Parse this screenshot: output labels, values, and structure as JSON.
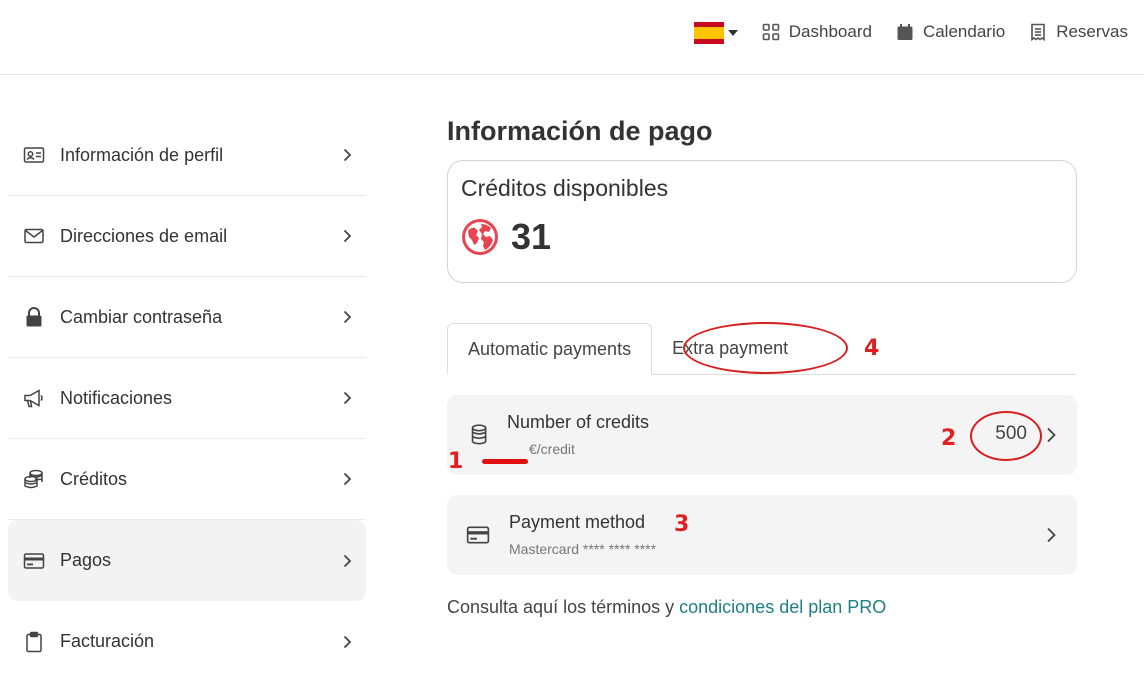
{
  "topbar": {
    "language": "es",
    "links": [
      {
        "label": "Dashboard",
        "icon": "dashboard-icon"
      },
      {
        "label": "Calendario",
        "icon": "calendar-icon"
      },
      {
        "label": "Reservas",
        "icon": "receipt-icon"
      }
    ]
  },
  "sidebar": {
    "items": [
      {
        "label": "Información de perfil",
        "icon": "id-card-icon"
      },
      {
        "label": "Direcciones de email",
        "icon": "envelope-icon"
      },
      {
        "label": "Cambiar contraseña",
        "icon": "lock-icon"
      },
      {
        "label": "Notificaciones",
        "icon": "megaphone-icon"
      },
      {
        "label": "Créditos",
        "icon": "coins-icon"
      },
      {
        "label": "Pagos",
        "icon": "credit-card-icon",
        "active": true
      },
      {
        "label": "Facturación",
        "icon": "clipboard-icon"
      }
    ]
  },
  "main": {
    "title": "Información de pago",
    "credits_card": {
      "title": "Créditos disponibles",
      "value": "31",
      "icon": "globe-icon"
    },
    "tabs": [
      {
        "label": "Automatic payments",
        "active": true
      },
      {
        "label": "Extra payment",
        "active": false
      }
    ],
    "credits_row": {
      "title": "Number of credits",
      "subtitle": "€/credit",
      "value": "500",
      "icon": "coins-icon"
    },
    "payment_row": {
      "title": "Payment method",
      "subtitle": "Mastercard **** **** ****",
      "icon": "credit-card-icon"
    },
    "terms": {
      "text": "Consulta aquí los términos y ",
      "link": "condiciones del plan PRO"
    }
  },
  "annotations": {
    "labels": [
      "1",
      "2",
      "3",
      "4"
    ],
    "color": "#e02020"
  },
  "colors": {
    "accent": "#1e7f86",
    "globe": "#e9434f"
  }
}
